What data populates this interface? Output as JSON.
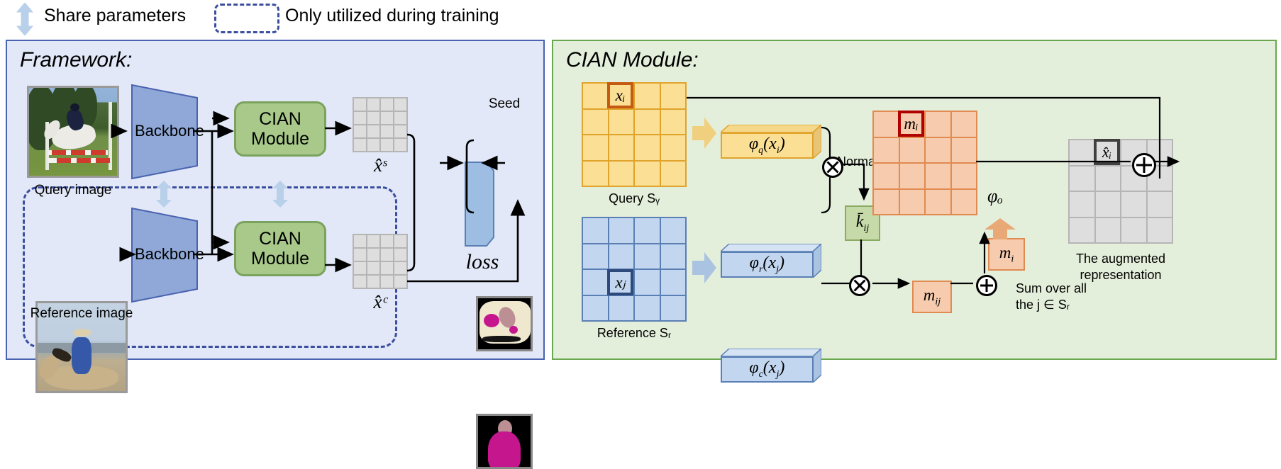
{
  "legend": {
    "share_parameters": "Share parameters",
    "only_training": "Only utilized during training"
  },
  "framework": {
    "title": "Framework:",
    "query_caption": "Query image",
    "reference_caption": "Reference image",
    "backbone_top": "Backbone",
    "backbone_bottom": "Backbone",
    "cian_top": "CIAN\nModule",
    "cian_top_line1": "CIAN",
    "cian_top_line2": "Module",
    "cian_bottom_line1": "CIAN",
    "cian_bottom_line2": "Module",
    "xhat_s": "x̂ˢ",
    "xhat_c": "x̂ᶜ",
    "loss": "loss",
    "seed": "Seed"
  },
  "cian": {
    "title": "CIAN Module:",
    "query_grid_label": "Query Sᵧ",
    "query_cell": "xᵢ",
    "reference_grid_label": "Reference Sᵣ",
    "reference_cell": "xⱼ",
    "phi_q": "φₐ(xᵢ)",
    "phi_q_sub": "q",
    "phi_r": "φᵣ(xⱼ)",
    "phi_c": "φᶜ(xⱼ)",
    "normalization": "Normalization",
    "k_bar": "k̄ᵢⱼ",
    "m_ij": "mᵢⱼ",
    "m_i": "mᵢ",
    "m_i_grid_cell": "mᵢ",
    "sum_line1": "Sum over all",
    "sum_line2": "the j ∈ Sᵣ",
    "phi_o": "φₒ",
    "xhat_i": "x̂ᵢ",
    "augmented_line1": "The augmented",
    "augmented_line2": "representation",
    "op_multiply": "⊗",
    "op_add": "⊕"
  },
  "colors": {
    "framework_bg": "#e2e8f7",
    "framework_border": "#4a63b0",
    "cian_bg": "#e4efdb",
    "cian_border": "#6aa84f",
    "cian_module": "#a8c98a",
    "backbone": "#8fa8d8",
    "query_grid": "#fbdf95",
    "reference_grid": "#c2d6ef",
    "m_grid": "#f7cbad",
    "highlight_query": "#c55a11",
    "highlight_reference": "#2e4a7d",
    "highlight_m": "#b00000",
    "highlight_out": "#404040",
    "dashed": "#3b4f9e",
    "share_arrow": "#b8d0ea"
  }
}
